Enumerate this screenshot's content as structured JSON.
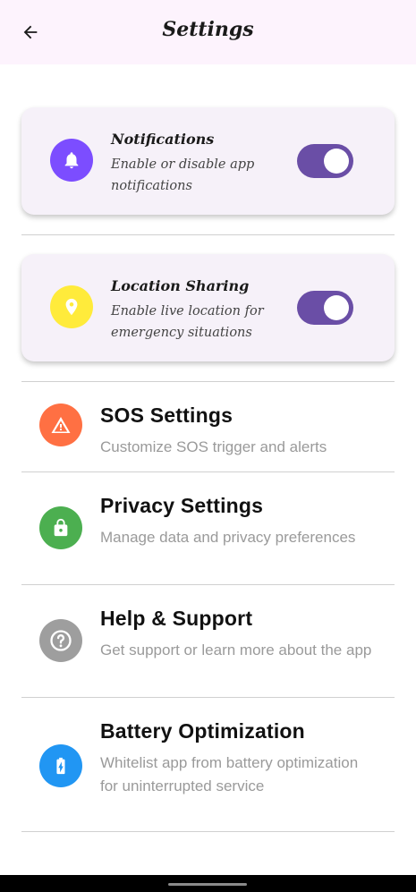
{
  "app_bar": {
    "title": "Settings",
    "back_icon": "arrow-left-icon",
    "background": "#fdf3fd"
  },
  "toggle_cards": [
    {
      "title": "Notifications",
      "subtitle": "Enable or disable app notifications",
      "icon": "bell-icon",
      "icon_color": "#7c4dff",
      "enabled": true
    },
    {
      "title": "Location Sharing",
      "subtitle": "Enable live location for emergency situations",
      "icon": "location-pin-icon",
      "icon_color": "#ffeb3b",
      "enabled": true
    }
  ],
  "toggle_color": "#6a4ea6",
  "settings_list": [
    {
      "title": "SOS Settings",
      "subtitle": "Customize SOS trigger and alerts",
      "icon": "warning-icon",
      "icon_color": "#ff7043"
    },
    {
      "title": "Privacy Settings",
      "subtitle": "Manage data and privacy preferences",
      "icon": "lock-icon",
      "icon_color": "#4caf50"
    },
    {
      "title": "Help & Support",
      "subtitle": "Get support or learn more about the app",
      "icon": "help-circle-icon",
      "icon_color": "#9e9e9e"
    },
    {
      "title": "Battery Optimization",
      "subtitle": "Whitelist app from battery optimization for uninterrupted service",
      "icon": "battery-charging-icon",
      "icon_color": "#2196f3"
    }
  ]
}
